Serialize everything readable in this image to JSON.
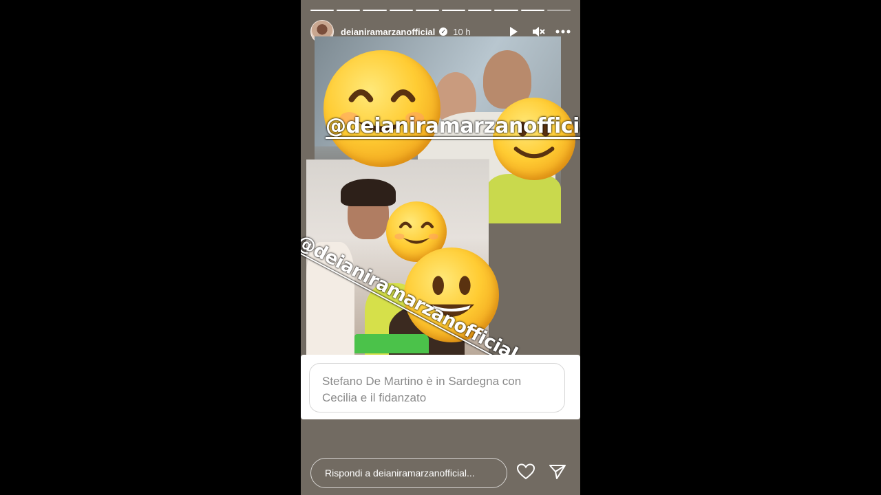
{
  "story": {
    "progress_total": 10,
    "progress_done": 9,
    "username": "deianiramarzanofficial",
    "verified_icon": "verified-badge-icon",
    "time_ago": "10 h",
    "icons": [
      "play-icon",
      "mute-icon",
      "more-options-icon"
    ]
  },
  "stickers": {
    "mention_top": "@deianiramarzanofficial",
    "mention_bottom": "@deianiramarzanofficial"
  },
  "question_box": {
    "text": "Stefano De Martino è in Sardegna con Cecilia e il fidanzato"
  },
  "reply": {
    "placeholder": "Rispondi a deianiramarzanofficial...",
    "icons": [
      "heart-icon",
      "send-icon"
    ]
  },
  "colors": {
    "story_bg": "#726b62",
    "emoji_yellow": "#ffcc33",
    "blur_green": "#4bc24a"
  }
}
